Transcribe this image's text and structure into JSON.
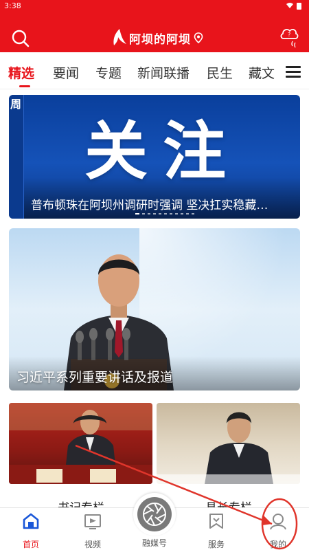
{
  "status": {
    "time": "3:38"
  },
  "header": {
    "app_title": "阿坝的阿坝",
    "search_icon": "search-icon",
    "weather_icon": "weather-cloud-icon"
  },
  "tabs": [
    {
      "label": "精选",
      "active": true
    },
    {
      "label": "要闻"
    },
    {
      "label": "专题"
    },
    {
      "label": "新闻联播"
    },
    {
      "label": "民生"
    },
    {
      "label": "藏文"
    }
  ],
  "banner": {
    "big_text": "关注",
    "side_char": "周",
    "caption": "普布顿珠在阿坝州调研时强调 坚决扛实稳藏…"
  },
  "feature": {
    "caption": "习近平系列重要讲话及报道"
  },
  "cards": [
    {
      "label": "书记专栏"
    },
    {
      "label": "县长专栏"
    }
  ],
  "nav": {
    "items": [
      {
        "label": "首页",
        "icon": "home-icon",
        "active": true
      },
      {
        "label": "视频",
        "icon": "video-icon"
      },
      {
        "label": "融媒号",
        "icon": "aperture-icon"
      },
      {
        "label": "服务",
        "icon": "service-icon"
      },
      {
        "label": "我的",
        "icon": "profile-icon"
      }
    ]
  },
  "colors": {
    "brand_red": "#e8141b",
    "annotation_red": "#e0352b"
  }
}
